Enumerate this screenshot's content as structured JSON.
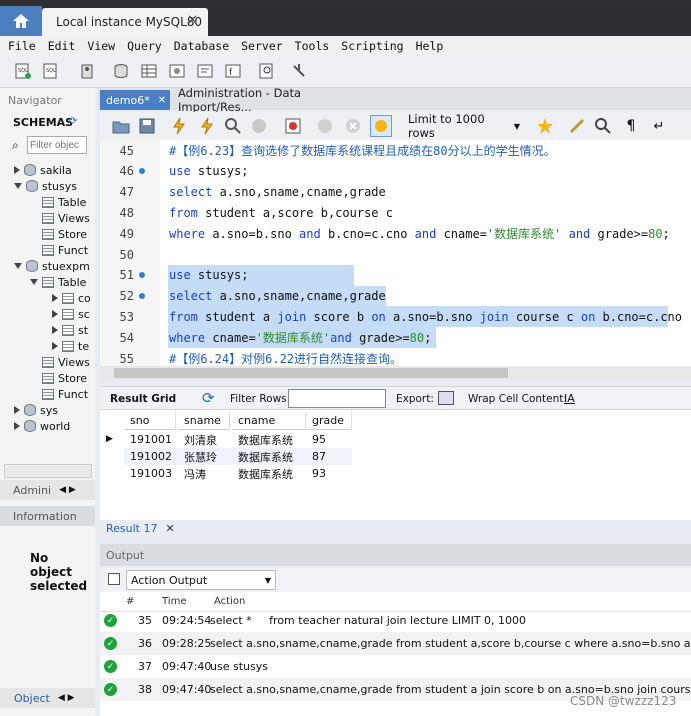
{
  "window": {
    "connection_tab": "Local instance MySQL80"
  },
  "menu": [
    "File",
    "Edit",
    "View",
    "Query",
    "Database",
    "Server",
    "Tools",
    "Scripting",
    "Help"
  ],
  "navigator": {
    "title": "Navigator",
    "schemas_label": "SCHEMAS",
    "filter_placeholder": "Filter objec",
    "tree": [
      "sakila",
      "stusys",
      "Table",
      "Views",
      "Store",
      "Funct",
      "stuexpm",
      "Table",
      "co",
      "sc",
      "st",
      "te",
      "Views",
      "Store",
      "Funct",
      "sys",
      "world"
    ],
    "admin_tab": "Admini",
    "info_tab": "Information",
    "no_object": "No object selected",
    "object_tab": "Object"
  },
  "editor": {
    "tabs": [
      "demo6*",
      "Administration - Data Import/Res..."
    ],
    "limit": "Limit to 1000 rows",
    "lines": [
      {
        "n": "45",
        "parts": [
          {
            "t": "#【例6.23】查询选修了数据库系统课程且成绩在80分以上的学生情况。",
            "c": "cm"
          }
        ]
      },
      {
        "n": "46",
        "parts": [
          {
            "t": "use",
            "c": "kw"
          },
          {
            "t": " stusys;",
            "c": ""
          }
        ]
      },
      {
        "n": "47",
        "parts": [
          {
            "t": "select",
            "c": "kw"
          },
          {
            "t": " a.sno,sname,cname,grade",
            "c": ""
          }
        ]
      },
      {
        "n": "48",
        "parts": [
          {
            "t": "from",
            "c": "kw"
          },
          {
            "t": " student a,score b,course c",
            "c": ""
          }
        ]
      },
      {
        "n": "49",
        "parts": [
          {
            "t": "where",
            "c": "kw"
          },
          {
            "t": " a.sno=b.sno ",
            "c": ""
          },
          {
            "t": "and",
            "c": "kw"
          },
          {
            "t": " b.cno=c.cno ",
            "c": ""
          },
          {
            "t": "and",
            "c": "kw"
          },
          {
            "t": " cname=",
            "c": ""
          },
          {
            "t": "'数据库系统'",
            "c": "st"
          },
          {
            "t": " ",
            "c": ""
          },
          {
            "t": "and",
            "c": "kw"
          },
          {
            "t": " grade>=",
            "c": ""
          },
          {
            "t": "80",
            "c": "nu"
          },
          {
            "t": ";",
            "c": ""
          }
        ]
      },
      {
        "n": "50",
        "parts": []
      },
      {
        "n": "51",
        "parts": [
          {
            "t": "use",
            "c": "kw"
          },
          {
            "t": " stusys;",
            "c": ""
          }
        ]
      },
      {
        "n": "52",
        "parts": [
          {
            "t": "select",
            "c": "kw"
          },
          {
            "t": " a.sno,sname,cname,grade",
            "c": ""
          }
        ]
      },
      {
        "n": "53",
        "parts": [
          {
            "t": "from",
            "c": "kw"
          },
          {
            "t": " student a ",
            "c": ""
          },
          {
            "t": "join",
            "c": "kw"
          },
          {
            "t": " score b ",
            "c": ""
          },
          {
            "t": "on",
            "c": "kw"
          },
          {
            "t": " a.sno=b.sno ",
            "c": ""
          },
          {
            "t": "join",
            "c": "kw"
          },
          {
            "t": " course c ",
            "c": ""
          },
          {
            "t": "on",
            "c": "kw"
          },
          {
            "t": " b.cno=c.cno",
            "c": ""
          }
        ]
      },
      {
        "n": "54",
        "parts": [
          {
            "t": "where",
            "c": "kw"
          },
          {
            "t": " cname=",
            "c": ""
          },
          {
            "t": "'数据库系统'",
            "c": "st"
          },
          {
            "t": "and",
            "c": "kw"
          },
          {
            "t": " grade>=",
            "c": ""
          },
          {
            "t": "80",
            "c": "nu"
          },
          {
            "t": ";",
            "c": ""
          }
        ]
      },
      {
        "n": "55",
        "parts": [
          {
            "t": "#【例6.24】对例6.22进行自然连接查询。",
            "c": "cm"
          }
        ]
      }
    ]
  },
  "result": {
    "grid_label": "Result Grid",
    "filter_label": "Filter Rows:",
    "export_label": "Export:",
    "wrap_label": "Wrap Cell Content:",
    "columns": [
      "sno",
      "sname",
      "cname",
      "grade"
    ],
    "rows": [
      [
        "191001",
        "刘清泉",
        "数据库系统",
        "95"
      ],
      [
        "191002",
        "张慧玲",
        "数据库系统",
        "87"
      ],
      [
        "191003",
        "冯涛",
        "数据库系统",
        "93"
      ]
    ],
    "tab": "Result 17"
  },
  "output": {
    "title": "Output",
    "selector": "Action Output",
    "columns": [
      "#",
      "Time",
      "Action"
    ],
    "rows": [
      [
        "35",
        "09:24:54",
        "select *     from teacher natural join lecture LIMIT 0, 1000"
      ],
      [
        "36",
        "09:28:25",
        "select a.sno,sname,cname,grade from student a,score b,course c where a.sno=b.sno and b.cno=c.cn"
      ],
      [
        "37",
        "09:47:40",
        "use stusys"
      ],
      [
        "38",
        "09:47:40",
        "select a.sno,sname,cname,grade from student a join score b on a.sno=b.sno join course c on b.cno=c"
      ]
    ]
  },
  "watermark": "CSDN @twzzz123",
  "colors": {
    "accent": "#4a7fc3",
    "selection": "#c4dcf6",
    "keyword": "#1a3fc2",
    "string": "#2f8c2f",
    "ok": "#1ea33a"
  }
}
